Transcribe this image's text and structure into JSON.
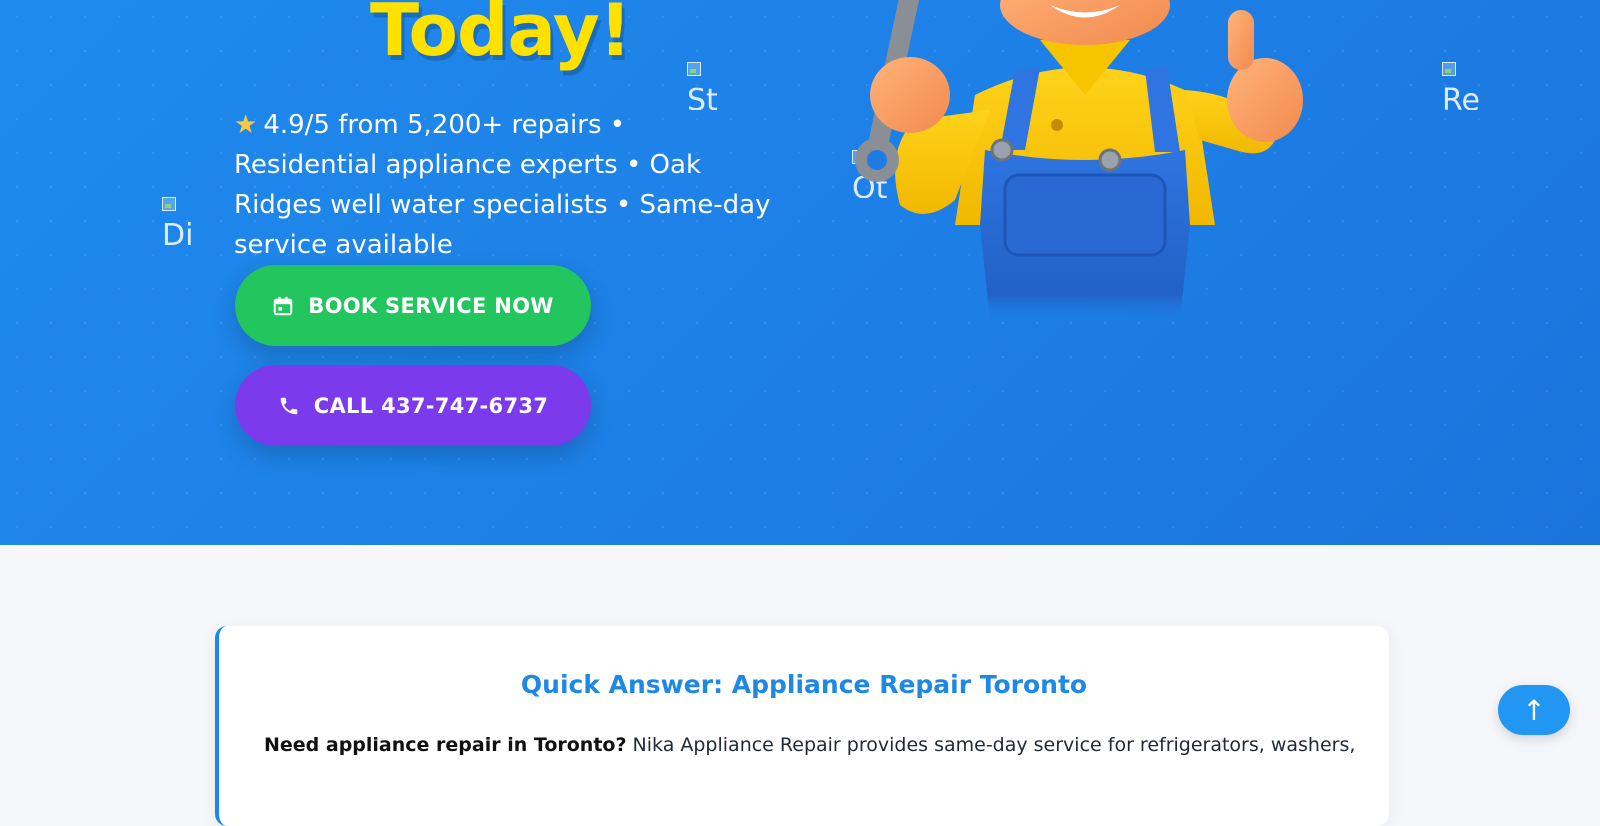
{
  "hero": {
    "title": "Today!",
    "rating_star_icon": "star-icon",
    "subtitle": "4.9/5 from 5,200+ repairs • Residential appliance experts • Oak Ridges well water specialists • Same-day service available",
    "broken_images": [
      {
        "alt_fragment": "Di"
      },
      {
        "alt_fragment": "St"
      },
      {
        "alt_fragment": "Ot"
      },
      {
        "alt_fragment": "Re"
      }
    ],
    "book_button_label": "BOOK SERVICE NOW",
    "book_button_icon": "calendar-icon",
    "call_button_label": "CALL 437-747-6737",
    "call_button_icon": "phone-icon",
    "mascot": "technician-mascot-thumbs-up",
    "colors": {
      "background": "#1f8aec",
      "title": "#ffe100",
      "book_button": "#22c55e",
      "call_button": "#7c3aed"
    }
  },
  "quick_answer": {
    "title": "Quick Answer: Appliance Repair Toronto",
    "lead_bold": "Need appliance repair in Toronto?",
    "lead_text": "Nika Appliance Repair provides same-day service for refrigerators, washers,",
    "accent_color": "#1e88e5"
  },
  "scroll_top": {
    "icon": "arrow-up-icon",
    "label": "↑"
  }
}
